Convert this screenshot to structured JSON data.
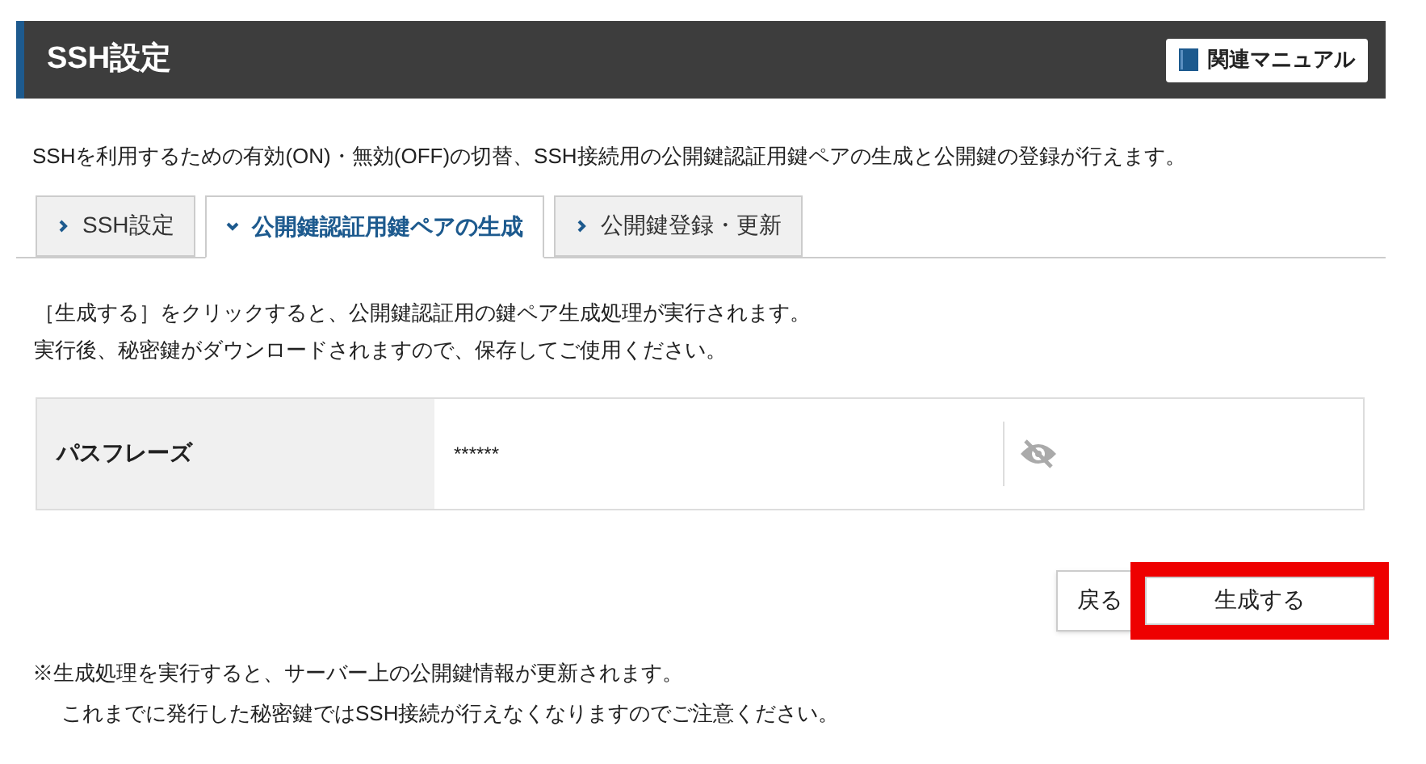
{
  "header": {
    "title": "SSH設定",
    "manual_button": "関連マニュアル"
  },
  "description": "SSHを利用するための有効(ON)・無効(OFF)の切替、SSH接続用の公開鍵認証用鍵ペアの生成と公開鍵の登録が行えます。",
  "tabs": [
    {
      "label": "SSH設定",
      "selected": false
    },
    {
      "label": "公開鍵認証用鍵ペアの生成",
      "selected": true
    },
    {
      "label": "公開鍵登録・更新",
      "selected": false
    }
  ],
  "instructions": [
    "［生成する］をクリックすると、公開鍵認証用の鍵ペア生成処理が実行されます。",
    "実行後、秘密鍵がダウンロードされますので、保存してご使用ください。"
  ],
  "form": {
    "label": "パスフレーズ",
    "value": "******"
  },
  "buttons": [
    {
      "label": "戻る",
      "highlighted": false
    },
    {
      "label": "生成する",
      "highlighted": true
    }
  ],
  "notes": [
    "※生成処理を実行すると、サーバー上の公開鍵情報が更新されます。",
    "これまでに発行した秘密鍵ではSSH接続が行えなくなりますのでご注意ください。"
  ]
}
